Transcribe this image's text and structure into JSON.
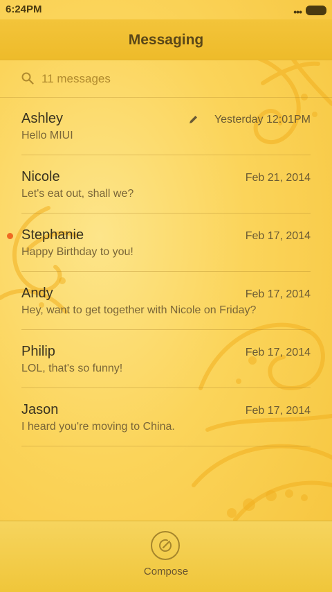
{
  "status_bar": {
    "time": "6:24PM",
    "more": "•••"
  },
  "header": {
    "title": "Messaging"
  },
  "search": {
    "placeholder": "11 messages"
  },
  "messages": [
    {
      "name": "Ashley",
      "date": "Yesterday 12:01PM",
      "preview": "Hello MIUI",
      "draft": true,
      "unread": false
    },
    {
      "name": "Nicole",
      "date": "Feb 21, 2014",
      "preview": "Let's eat out, shall we?",
      "draft": false,
      "unread": false
    },
    {
      "name": "Stephanie",
      "date": "Feb 17, 2014",
      "preview": "Happy Birthday to you!",
      "draft": false,
      "unread": true
    },
    {
      "name": "Andy",
      "date": "Feb 17, 2014",
      "preview": "Hey, want to get together with Nicole on Friday?",
      "draft": false,
      "unread": false
    },
    {
      "name": "Philip",
      "date": "Feb 17, 2014",
      "preview": "LOL, that's so funny!",
      "draft": false,
      "unread": false
    },
    {
      "name": "Jason",
      "date": "Feb 17, 2014",
      "preview": "I heard you're moving to China.",
      "draft": false,
      "unread": false
    }
  ],
  "footer": {
    "compose_label": "Compose"
  },
  "colors": {
    "accent": "#f0c63a",
    "unread_dot": "#ef6a22"
  },
  "icons": {
    "search": "search-icon",
    "draft": "pencil-icon",
    "compose": "compose-icon"
  }
}
